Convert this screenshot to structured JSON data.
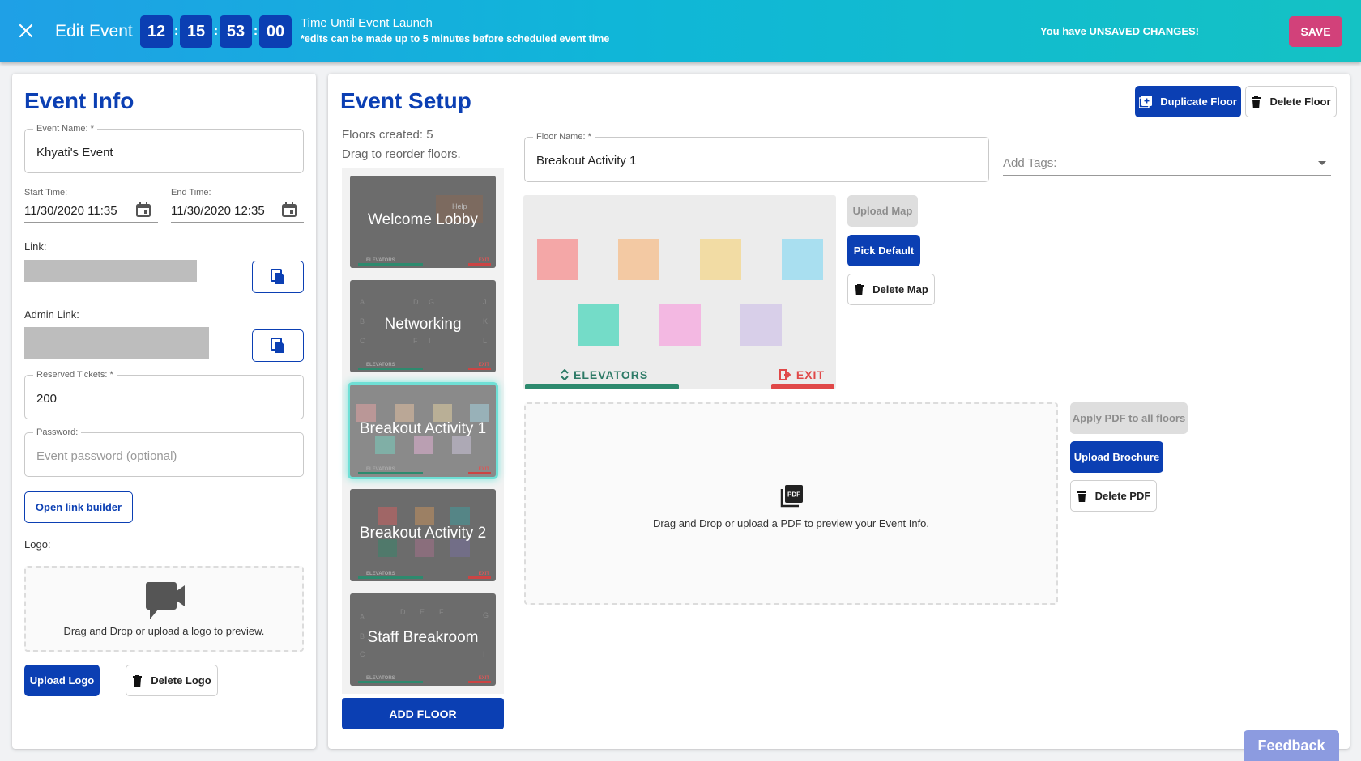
{
  "header": {
    "title": "Edit Event",
    "countdown": [
      "12",
      "15",
      "53",
      "00"
    ],
    "countdown_sep": ":",
    "info_line1": "Time Until Event Launch",
    "info_line2": "*edits can be made up to 5 minutes before scheduled event time",
    "unsaved": "You have UNSAVED CHANGES!",
    "save": "SAVE"
  },
  "event_info": {
    "title": "Event Info",
    "event_name_label": "Event Name: *",
    "event_name": "Khyati's Event",
    "start_label": "Start Time:",
    "start_value": "11/30/2020 11:35",
    "end_label": "End Time:",
    "end_value": "11/30/2020 12:35",
    "link_label": "Link:",
    "admin_link_label": "Admin Link:",
    "tickets_label": "Reserved Tickets: *",
    "tickets_value": "200",
    "password_label": "Password:",
    "password_placeholder": "Event password (optional)",
    "link_builder": "Open link builder",
    "logo_label": "Logo:",
    "logo_drop": "Drag and Drop or upload a logo to preview.",
    "upload_logo": "Upload Logo",
    "delete_logo": "Delete Logo"
  },
  "event_setup": {
    "title": "Event Setup",
    "floors_created": "Floors created: 5",
    "drag_hint": "Drag to reorder floors.",
    "duplicate_floor": "Duplicate Floor",
    "delete_floor": "Delete Floor",
    "floor_name_label": "Floor Name: *",
    "floor_name": "Breakout Activity 1",
    "tags_placeholder": "Add Tags:",
    "upload_map": "Upload Map",
    "pick_default": "Pick Default",
    "delete_map": "Delete Map",
    "map_elevators": "ELEVATORS",
    "map_exit": "EXIT",
    "pdf_drop": "Drag and Drop or upload a PDF to preview your Event Info.",
    "apply_pdf": "Apply PDF to all floors",
    "upload_brochure": "Upload Brochure",
    "delete_pdf": "Delete PDF",
    "add_floor": "ADD FLOOR",
    "tile_elevators": "ELEVATORS",
    "tile_exit": "EXIT",
    "floors": [
      {
        "name": "Welcome Lobby",
        "active": false
      },
      {
        "name": "Networking",
        "active": false
      },
      {
        "name": "Breakout Activity 1",
        "active": true
      },
      {
        "name": "Breakout Activity 2",
        "active": false
      },
      {
        "name": "Staff Breakroom",
        "active": false
      }
    ],
    "tile_help": "Help",
    "tile_letters_networking": [
      "A",
      "D",
      "G",
      "J",
      "B",
      "K",
      "C",
      "F",
      "I",
      "L"
    ],
    "tile_letters_staff": [
      "A",
      "D",
      "E",
      "F",
      "G",
      "B",
      "C",
      "I"
    ]
  },
  "map_colors": [
    "#f4a7a7",
    "#f3c9a3",
    "#f2dca4",
    "#a9dff0",
    "#74dcc8",
    "#f3b8e2",
    "#d8cfe9"
  ],
  "accent": "#0b3fb3",
  "save_color": "#d2417a",
  "feedback": "Feedback"
}
